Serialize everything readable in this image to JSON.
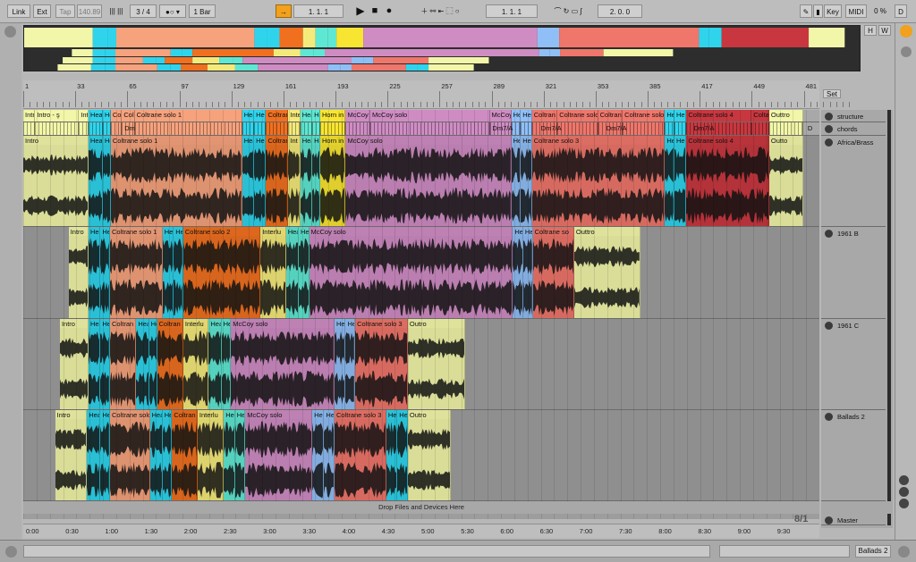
{
  "colors": {
    "intro": "#f2f6a8",
    "head": "#2fd4ec",
    "coltrane": "#f6a27d",
    "interlude": "#f4ea7b",
    "orange": "#f07020",
    "teal": "#5ee8d3",
    "mccoy": "#cf8cc3",
    "blue": "#90bff7",
    "salmon": "#ef766b",
    "red": "#c8373f",
    "yellow": "#f8e531",
    "lilac": "#c0acdd"
  },
  "topbar": {
    "link": "Link",
    "ext": "Ext",
    "tap": "Tap",
    "tempo": "140.89",
    "signature": "3 / 4",
    "quant": "1 Bar",
    "pos": "1.   1.   1",
    "loop_start": "1.   1.   1",
    "loop_len": "2.   0.   0",
    "key": "Key",
    "midi": "MIDI",
    "cpu": "0 %",
    "d": "D"
  },
  "overview": {
    "h": "H",
    "w": "W"
  },
  "ruler": {
    "bars": [
      "1",
      "33",
      "65",
      "97",
      "129",
      "161",
      "193",
      "225",
      "257",
      "289",
      "321",
      "353",
      "385",
      "417",
      "449",
      "481"
    ],
    "set_label": "Set"
  },
  "structure_clips": [
    {
      "label": "Intro",
      "color": "#f2f6a8",
      "start": 0,
      "end": 1.5
    },
    {
      "label": "Intro - ş",
      "color": "#f2f6a8",
      "start": 1.5,
      "end": 7
    },
    {
      "label": "Intro - t",
      "color": "#f2f6a8",
      "start": 7,
      "end": 8.2
    },
    {
      "label": "Hea",
      "color": "#2fd4ec",
      "start": 8.2,
      "end": 10
    },
    {
      "label": "He",
      "color": "#2fd4ec",
      "start": 10,
      "end": 11
    },
    {
      "label": "Col",
      "color": "#f6a27d",
      "start": 11,
      "end": 12.4
    },
    {
      "label": "Col",
      "color": "#f6a27d",
      "start": 12.4,
      "end": 14
    },
    {
      "label": "Coltrane solo 1",
      "color": "#f6a27d",
      "start": 14,
      "end": 27.5
    },
    {
      "label": "Hea",
      "color": "#2fd4ec",
      "start": 27.5,
      "end": 29
    },
    {
      "label": "He",
      "color": "#2fd4ec",
      "start": 29,
      "end": 30.5
    },
    {
      "label": "Coltran",
      "color": "#f07020",
      "start": 30.5,
      "end": 33.3
    },
    {
      "label": "Inte",
      "color": "#f4ea7b",
      "start": 33.3,
      "end": 34.8
    },
    {
      "label": "Hea",
      "color": "#5ee8d3",
      "start": 34.8,
      "end": 36.3
    },
    {
      "label": "He",
      "color": "#5ee8d3",
      "start": 36.3,
      "end": 37.3
    },
    {
      "label": "Horn in",
      "color": "#f8e531",
      "start": 37.3,
      "end": 40.5
    },
    {
      "label": "McCoy",
      "color": "#cf8cc3",
      "start": 40.5,
      "end": 43.6
    },
    {
      "label": "McCoy solo",
      "color": "#cf8cc3",
      "start": 43.6,
      "end": 58.6
    },
    {
      "label": "McCoy",
      "color": "#cf8cc3",
      "start": 58.6,
      "end": 61.3
    },
    {
      "label": "Hea",
      "color": "#90bff7",
      "start": 61.3,
      "end": 62.5
    },
    {
      "label": "He",
      "color": "#90bff7",
      "start": 62.5,
      "end": 63.9
    },
    {
      "label": "Coltran",
      "color": "#ef766b",
      "start": 63.9,
      "end": 67.1
    },
    {
      "label": "Coltrane solo",
      "color": "#ef766b",
      "start": 67.1,
      "end": 72.2
    },
    {
      "label": "Coltrane",
      "color": "#ef766b",
      "start": 72.2,
      "end": 75.3
    },
    {
      "label": "Coltrane solo",
      "color": "#ef766b",
      "start": 75.3,
      "end": 80.6
    },
    {
      "label": "Hea",
      "color": "#2fd4ec",
      "start": 80.6,
      "end": 81.8
    },
    {
      "label": "He",
      "color": "#2fd4ec",
      "start": 81.8,
      "end": 83.3
    },
    {
      "label": "Coltrane solo 4",
      "color": "#c8373f",
      "start": 83.3,
      "end": 91.5
    },
    {
      "label": "Colta",
      "color": "#c8373f",
      "start": 91.5,
      "end": 93.7
    },
    {
      "label": "Outtro",
      "color": "#f2f6a8",
      "start": 93.7,
      "end": 98
    }
  ],
  "chord_labels": [
    {
      "label": "Dm",
      "pos": 12.5
    },
    {
      "label": "Dm7/A",
      "pos": 58.7
    },
    {
      "label": "Dm7/A",
      "pos": 64.8
    },
    {
      "label": "Dm7/A",
      "pos": 73
    },
    {
      "label": "Dm7/A",
      "pos": 84
    },
    {
      "label": "D",
      "pos": 98.3
    }
  ],
  "track1_clips": [
    {
      "label": "Intro",
      "color": "#f2f6a8",
      "start": 0,
      "end": 8.2
    },
    {
      "label": "Hea",
      "color": "#2fd4ec",
      "start": 8.2,
      "end": 10
    },
    {
      "label": "He",
      "color": "#2fd4ec",
      "start": 10,
      "end": 11
    },
    {
      "label": "Coltrane solo 1",
      "color": "#f6a27d",
      "start": 11,
      "end": 27.5
    },
    {
      "label": "Hea",
      "color": "#2fd4ec",
      "start": 27.5,
      "end": 29
    },
    {
      "label": "He",
      "color": "#2fd4ec",
      "start": 29,
      "end": 30.5
    },
    {
      "label": "Coltran",
      "color": "#f07020",
      "start": 30.5,
      "end": 33.3
    },
    {
      "label": "Int",
      "color": "#f4ea7b",
      "start": 33.3,
      "end": 34.8
    },
    {
      "label": "Hea",
      "color": "#5ee8d3",
      "start": 34.8,
      "end": 36.3
    },
    {
      "label": "He",
      "color": "#5ee8d3",
      "start": 36.3,
      "end": 37.3
    },
    {
      "label": "Horn in",
      "color": "#f8e531",
      "start": 37.3,
      "end": 40.5
    },
    {
      "label": "McCoy solo",
      "color": "#cf8cc3",
      "start": 40.5,
      "end": 61.3
    },
    {
      "label": "Hea",
      "color": "#90bff7",
      "start": 61.3,
      "end": 62.5
    },
    {
      "label": "He",
      "color": "#90bff7",
      "start": 62.5,
      "end": 63.9
    },
    {
      "label": "Coltrane solo 3",
      "color": "#ef766b",
      "start": 63.9,
      "end": 80.6
    },
    {
      "label": "Hea",
      "color": "#2fd4ec",
      "start": 80.6,
      "end": 81.8
    },
    {
      "label": "He",
      "color": "#2fd4ec",
      "start": 81.8,
      "end": 83.3
    },
    {
      "label": "Coltrane solo 4",
      "color": "#c8373f",
      "start": 83.3,
      "end": 93.7
    },
    {
      "label": "Outto",
      "color": "#f2f6a8",
      "start": 93.7,
      "end": 98
    }
  ],
  "track2_clips": [
    {
      "label": "Intro",
      "color": "#f2f6a8",
      "start": 5.7,
      "end": 8.2
    },
    {
      "label": "Hea",
      "color": "#2fd4ec",
      "start": 8.2,
      "end": 9.7
    },
    {
      "label": "He",
      "color": "#2fd4ec",
      "start": 9.7,
      "end": 10.9
    },
    {
      "label": "Coltrane solo 1",
      "color": "#f6a27d",
      "start": 10.9,
      "end": 17.5
    },
    {
      "label": "Hea",
      "color": "#2fd4ec",
      "start": 17.5,
      "end": 18.9
    },
    {
      "label": "He",
      "color": "#2fd4ec",
      "start": 18.9,
      "end": 20.1
    },
    {
      "label": "Coltrane solo 2",
      "color": "#f07020",
      "start": 20.1,
      "end": 29.8
    },
    {
      "label": "Interlu",
      "color": "#f4ea7b",
      "start": 29.8,
      "end": 33.0
    },
    {
      "label": "Hea",
      "color": "#5ee8d3",
      "start": 33.0,
      "end": 34.6
    },
    {
      "label": "He",
      "color": "#5ee8d3",
      "start": 34.6,
      "end": 35.9
    },
    {
      "label": "McCoy solo",
      "color": "#cf8cc3",
      "start": 35.9,
      "end": 61.5
    },
    {
      "label": "Hea",
      "color": "#90bff7",
      "start": 61.5,
      "end": 62.8
    },
    {
      "label": "He",
      "color": "#90bff7",
      "start": 62.8,
      "end": 64
    },
    {
      "label": "Coltrane so",
      "color": "#ef766b",
      "start": 64,
      "end": 69.2
    },
    {
      "label": "Outtro",
      "color": "#f2f6a8",
      "start": 69.2,
      "end": 77.5
    }
  ],
  "track3_clips": [
    {
      "label": "Intro",
      "color": "#f2f6a8",
      "start": 4.6,
      "end": 8.2
    },
    {
      "label": "Hea",
      "color": "#2fd4ec",
      "start": 8.2,
      "end": 9.7
    },
    {
      "label": "He",
      "color": "#2fd4ec",
      "start": 9.7,
      "end": 10.9
    },
    {
      "label": "Coltran",
      "color": "#f6a27d",
      "start": 10.9,
      "end": 14.2
    },
    {
      "label": "Hea",
      "color": "#2fd4ec",
      "start": 14.2,
      "end": 15.8
    },
    {
      "label": "He",
      "color": "#2fd4ec",
      "start": 15.8,
      "end": 16.8
    },
    {
      "label": "Coltran",
      "color": "#f07020",
      "start": 16.8,
      "end": 20.1
    },
    {
      "label": "Interlu",
      "color": "#f4ea7b",
      "start": 20.1,
      "end": 23.3
    },
    {
      "label": "Hea",
      "color": "#5ee8d3",
      "start": 23.3,
      "end": 24.9
    },
    {
      "label": "He",
      "color": "#5ee8d3",
      "start": 24.9,
      "end": 26.1
    },
    {
      "label": "McCoy solo",
      "color": "#cf8cc3",
      "start": 26.1,
      "end": 39.1
    },
    {
      "label": "Hea",
      "color": "#90bff7",
      "start": 39.1,
      "end": 40.5
    },
    {
      "label": "He",
      "color": "#90bff7",
      "start": 40.5,
      "end": 41.7
    },
    {
      "label": "Coltrane solo 3",
      "color": "#ef766b",
      "start": 41.7,
      "end": 48.3
    },
    {
      "label": "Outro",
      "color": "#f2f6a8",
      "start": 48.3,
      "end": 55.5
    }
  ],
  "track4_clips": [
    {
      "label": "Intro",
      "color": "#f2f6a8",
      "start": 4.0,
      "end": 8.0
    },
    {
      "label": "Hea",
      "color": "#2fd4ec",
      "start": 8.0,
      "end": 9.7
    },
    {
      "label": "He",
      "color": "#2fd4ec",
      "start": 9.7,
      "end": 10.9
    },
    {
      "label": "Coltrane solo 1",
      "color": "#f6a27d",
      "start": 10.9,
      "end": 15.9
    },
    {
      "label": "Hea",
      "color": "#2fd4ec",
      "start": 15.9,
      "end": 17.5
    },
    {
      "label": "He",
      "color": "#2fd4ec",
      "start": 17.5,
      "end": 18.7
    },
    {
      "label": "Coltran",
      "color": "#f07020",
      "start": 18.7,
      "end": 21.9
    },
    {
      "label": "Interlu",
      "color": "#f4ea7b",
      "start": 21.9,
      "end": 25.2
    },
    {
      "label": "Hea",
      "color": "#5ee8d3",
      "start": 25.2,
      "end": 26.6
    },
    {
      "label": "He",
      "color": "#5ee8d3",
      "start": 26.6,
      "end": 27.9
    },
    {
      "label": "McCoy solo",
      "color": "#cf8cc3",
      "start": 27.9,
      "end": 36.3
    },
    {
      "label": "Hea",
      "color": "#90bff7",
      "start": 36.3,
      "end": 37.8
    },
    {
      "label": "He",
      "color": "#90bff7",
      "start": 37.8,
      "end": 39.1
    },
    {
      "label": "Coltrane solo 3",
      "color": "#ef766b",
      "start": 39.1,
      "end": 45.6
    },
    {
      "label": "Hea",
      "color": "#2fd4ec",
      "start": 45.6,
      "end": 47.0
    },
    {
      "label": "He",
      "color": "#2fd4ec",
      "start": 47.0,
      "end": 48.3
    },
    {
      "label": "Outro",
      "color": "#f2f6a8",
      "start": 48.3,
      "end": 53.7
    }
  ],
  "tracks": [
    {
      "name": "structure",
      "color": "#c0acdd"
    },
    {
      "name": "chords",
      "color": "#c0acdd"
    },
    {
      "name": "Africa/Brass",
      "color": "#c75a32"
    },
    {
      "name": "1961 B",
      "color": "#dcc08c"
    },
    {
      "name": "1961 C",
      "color": "#a58c75"
    },
    {
      "name": "Ballads 2",
      "color": "#cfe9f6"
    },
    {
      "name": "Master",
      "color": "#f48c93"
    }
  ],
  "dropzone": "Drop Files and Devices Here",
  "zoom": "8/1",
  "times": [
    "0:00",
    "0:30",
    "1:00",
    "1:30",
    "2:00",
    "2:30",
    "3:00",
    "3:30",
    "4:00",
    "4:30",
    "5:00",
    "5:30",
    "6:00",
    "6:30",
    "7:00",
    "7:30",
    "8:00",
    "8:30",
    "9:00",
    "9:30"
  ],
  "status": {
    "track": "Ballads 2"
  }
}
